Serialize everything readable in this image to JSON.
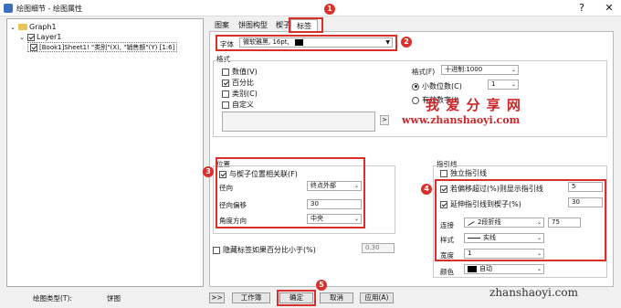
{
  "window": {
    "title": "绘图细节 - 绘图属性",
    "help": "?",
    "close": "✕"
  },
  "tree": {
    "graph": "Graph1",
    "layer": "Layer1",
    "plot": "[Book1]Sheet1! \"类别\"(X), \"销售额\"(Y) [1:6]"
  },
  "tabs": [
    "图案",
    "饼图构型",
    "楔子",
    "标签"
  ],
  "font": {
    "label": "字体",
    "value": "微软雅黑, 16pt,"
  },
  "format": {
    "group_title": "格式",
    "items": [
      {
        "label": "数值(V)",
        "checked": false
      },
      {
        "label": "百分比",
        "checked": true
      },
      {
        "label": "类别(C)",
        "checked": false
      },
      {
        "label": "自定义",
        "checked": false
      }
    ],
    "arrow": ">",
    "format_label": "格式(F)",
    "format_value": "十进制:1000",
    "decimal_label": "小数位数(C)",
    "decimal_value": "1",
    "sig_label": "有效数字(I)"
  },
  "position": {
    "group_title": "位置",
    "assoc_label": "与楔子位置相关联(F)",
    "assoc_checked": true,
    "direction_label": "径向",
    "direction_value": "终点外部",
    "offset_label": "径向偏移",
    "offset_value": "30",
    "angle_label": "角度方向",
    "angle_value": "中央"
  },
  "hide": {
    "label": "隐藏标签如果百分比小于(%)",
    "value": "0.30"
  },
  "leader": {
    "group_title": "指引线",
    "independent_label": "独立指引线",
    "show_label": "若偏移超过(%)则显示指引线",
    "show_value": "5",
    "extend_label": "延伸指引线到楔子(%)",
    "extend_value": "30",
    "connect_label": "连接",
    "connect_value": "2段折线",
    "connect_num": "75",
    "style_label": "样式",
    "style_value": "实线",
    "width_label": "宽度",
    "width_value": "1",
    "color_label": "颜色",
    "color_value": "自动"
  },
  "footer": {
    "type_label": "绘图类型(T):",
    "type_value": "饼图",
    "expand": ">>",
    "workbook": "工作簿",
    "ok": "确定",
    "cancel": "取消",
    "apply": "应用(A)"
  },
  "badges": [
    "1",
    "2",
    "3",
    "4",
    "5"
  ],
  "watermark": {
    "big": "我 爱 分 享 网",
    "url": "www.zhanshaoyi.com",
    "corner": "zhanshaoyi.com"
  },
  "colors": {
    "highlight": "#d9302a",
    "watermark": "#c8282a"
  }
}
